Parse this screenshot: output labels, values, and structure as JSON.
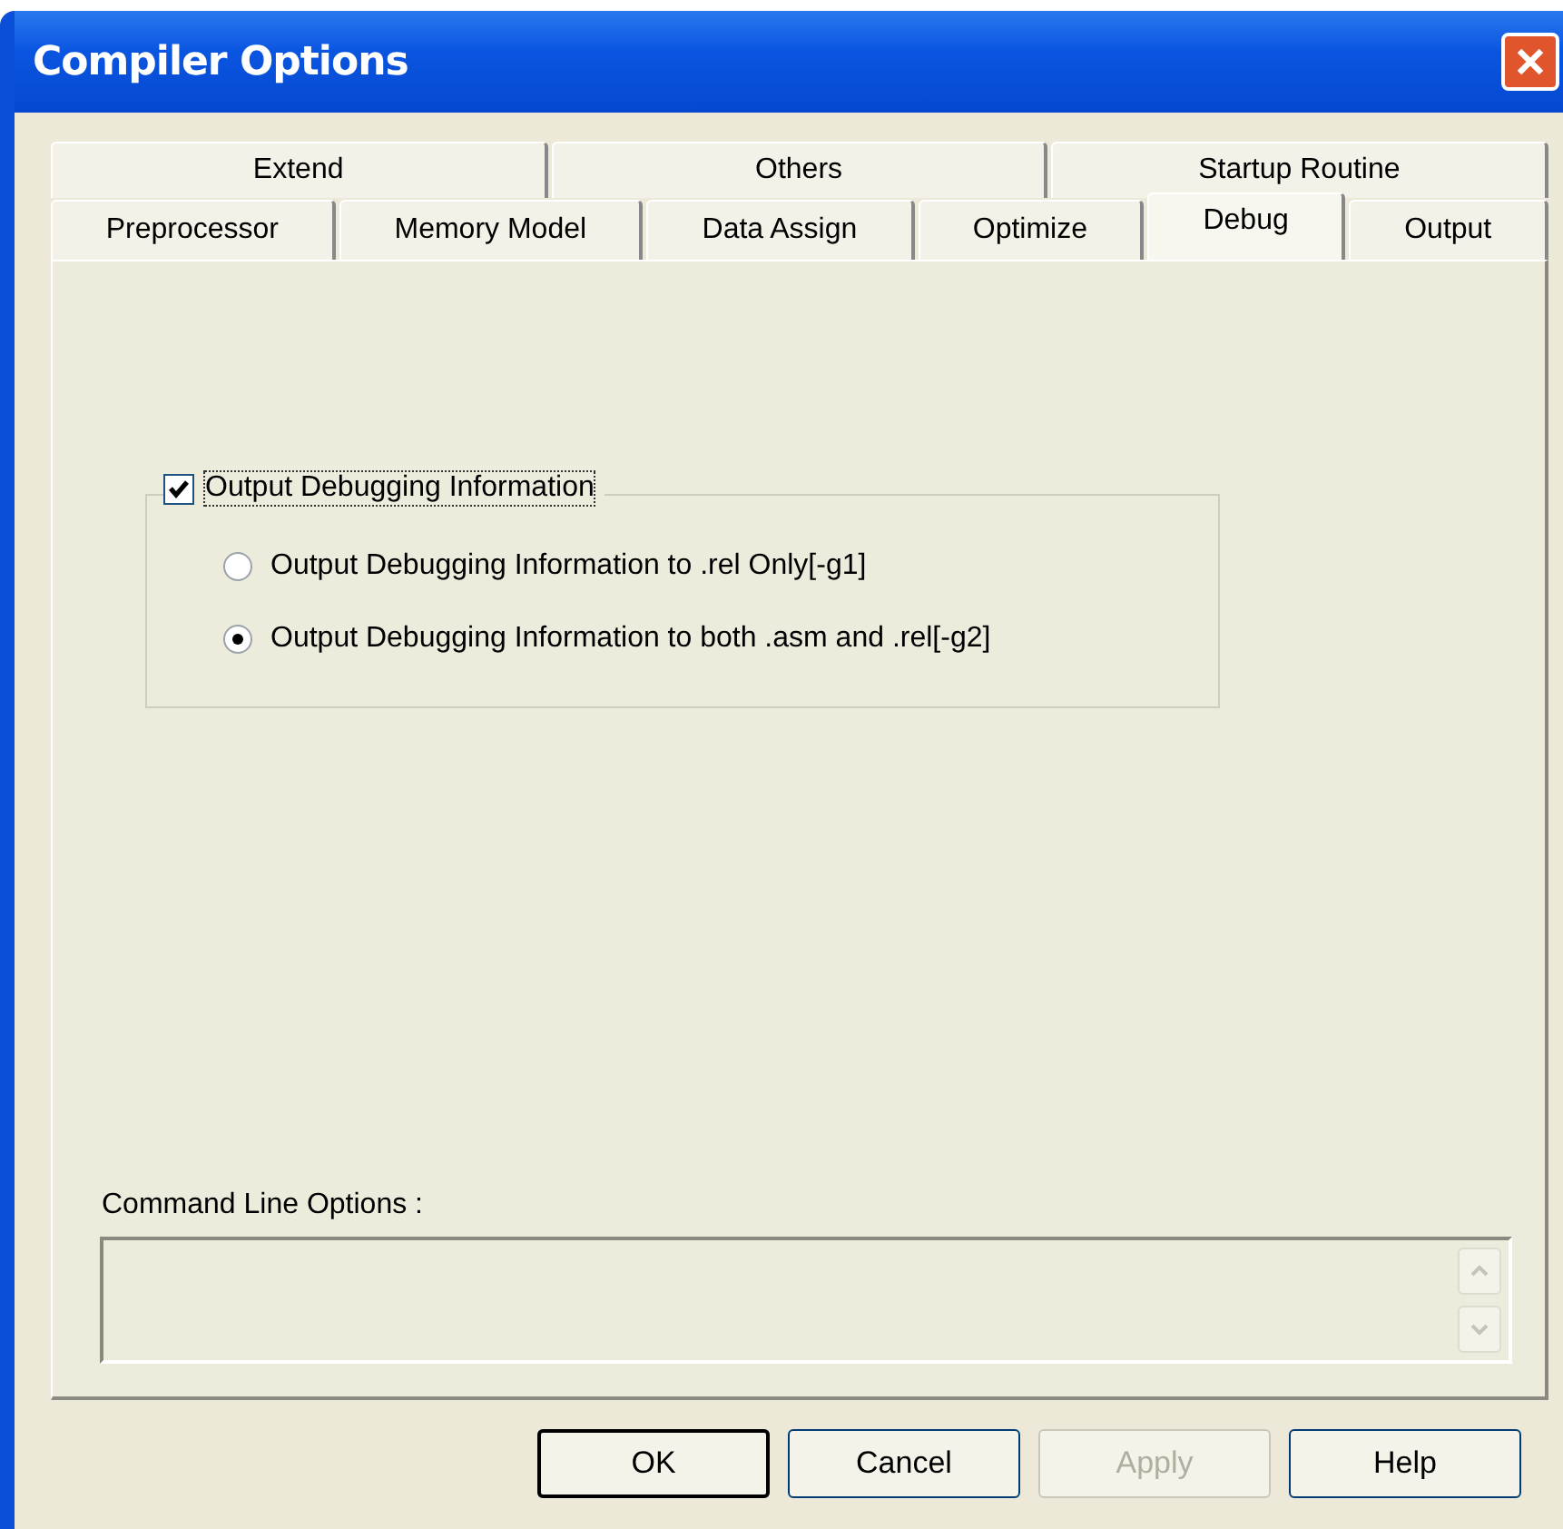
{
  "window": {
    "title": "Compiler Options"
  },
  "tabs_row_1": [
    {
      "label": "Extend",
      "selected": false
    },
    {
      "label": "Others",
      "selected": false
    },
    {
      "label": "Startup Routine",
      "selected": false
    }
  ],
  "tabs_row_2": [
    {
      "label": "Preprocessor",
      "selected": false
    },
    {
      "label": "Memory Model",
      "selected": false
    },
    {
      "label": "Data Assign",
      "selected": false
    },
    {
      "label": "Optimize",
      "selected": false
    },
    {
      "label": "Debug",
      "selected": true
    },
    {
      "label": "Output",
      "selected": false
    }
  ],
  "debug_group": {
    "checkbox": {
      "label": "Output Debugging Information",
      "checked": true
    },
    "options": [
      {
        "label": "Output Debugging Information to .rel Only[-g1]",
        "selected": false
      },
      {
        "label": "Output Debugging Information to both .asm and .rel[-g2]",
        "selected": true
      }
    ]
  },
  "command_line": {
    "label": "Command Line Options :"
  },
  "buttons": [
    {
      "label": "OK",
      "disabled": false,
      "default": true
    },
    {
      "label": "Cancel",
      "disabled": false,
      "default": false
    },
    {
      "label": "Apply",
      "disabled": true,
      "default": false
    },
    {
      "label": "Help",
      "disabled": false,
      "default": false
    }
  ]
}
